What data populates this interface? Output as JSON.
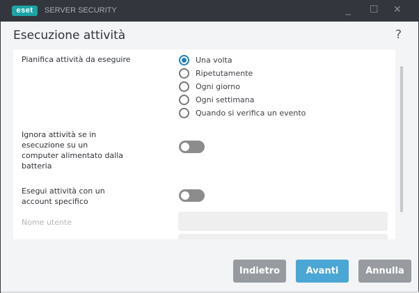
{
  "window": {
    "logo": "eset",
    "app_name": "SERVER SECURITY",
    "minimize": "_",
    "maximize": "☐",
    "close": "✕"
  },
  "page": {
    "title": "Esecuzione attività",
    "help": "?"
  },
  "schedule": {
    "label": "Pianifica attività da eseguire",
    "options": [
      "Una volta",
      "Ripetutamente",
      "Ogni giorno",
      "Ogni settimana",
      "Quando si verifica un evento"
    ],
    "selected": "Una volta"
  },
  "battery": {
    "label": "Ignora attività se in esecuzione su un computer alimentato dalla batteria",
    "enabled": false
  },
  "account": {
    "label": "Esegui attività con un account specifico",
    "enabled": false
  },
  "username": {
    "label": "Nome utente",
    "value": ""
  },
  "buttons": {
    "back": "Indietro",
    "next": "Avanti",
    "cancel": "Annulla"
  },
  "colors": {
    "accent": "#4aa6d5",
    "titlebar": "#33363c",
    "logo": "#1aa4a4"
  }
}
